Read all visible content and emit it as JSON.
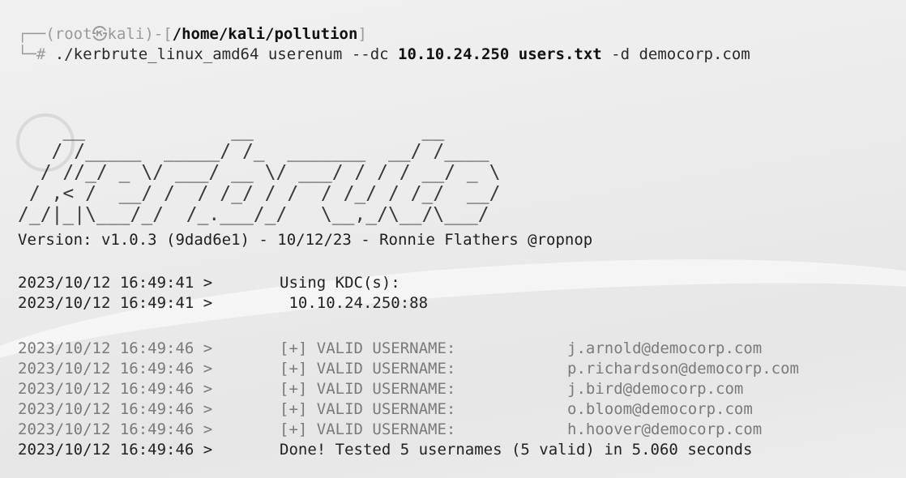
{
  "prompt": {
    "open": "┌──(",
    "user": "root",
    "at": "㉿",
    "host": "kali",
    "mid": ")-[",
    "path": "/home/kali/pollution",
    "close": "]",
    "line2_prefix": "└─# ",
    "command_part1": "./kerbrute_linux_amd64 userenum --dc ",
    "dc_ip": "10.10.24.250",
    "space": " ",
    "userfile": "users.txt",
    "command_part2": " -d democorp.com"
  },
  "banner": "    __             __               __     \n   / /_____  _____/ /_  _______  __/ /____ \n  / //_/ _ \\/ ___/ __ \\/ ___/ / / / __/ _ \\\n / ,< /  __/ /  / /_/ / /  / /_/ / /_/  __/\n/_/|_|\\___/_/  /_.___/_/   \\__,_/\\__/\\___/ ",
  "version_line": "Version: v1.0.3 (9dad6e1) - 10/12/23 - Ronnie Flathers @ropnop",
  "kdc": [
    {
      "time": "2023/10/12 16:49:41 >",
      "msg": "Using KDC(s):"
    },
    {
      "time": "2023/10/12 16:49:41 >",
      "msg": " 10.10.24.250:88"
    }
  ],
  "valid_users": [
    {
      "time": "2023/10/12 16:49:46 >",
      "msg": "[+] VALID USERNAME:",
      "user": "j.arnold@democorp.com"
    },
    {
      "time": "2023/10/12 16:49:46 >",
      "msg": "[+] VALID USERNAME:",
      "user": "p.richardson@democorp.com"
    },
    {
      "time": "2023/10/12 16:49:46 >",
      "msg": "[+] VALID USERNAME:",
      "user": "j.bird@democorp.com"
    },
    {
      "time": "2023/10/12 16:49:46 >",
      "msg": "[+] VALID USERNAME:",
      "user": "o.bloom@democorp.com"
    },
    {
      "time": "2023/10/12 16:49:46 >",
      "msg": "[+] VALID USERNAME:",
      "user": "h.hoover@democorp.com"
    }
  ],
  "done": {
    "time": "2023/10/12 16:49:46 >",
    "msg": "Done! Tested 5 usernames (5 valid) in 5.060 seconds"
  },
  "colors": {
    "background": "#ececec",
    "text": "#222222",
    "faint": "#9a9a9a",
    "dim": "#7a7a7a"
  }
}
